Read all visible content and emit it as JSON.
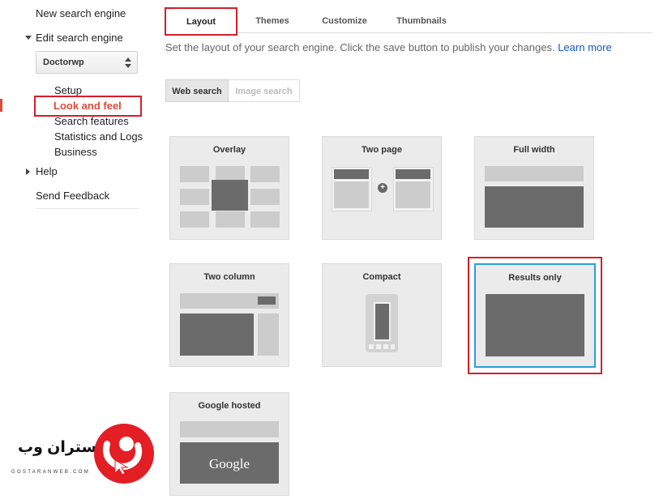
{
  "sidebar": {
    "new_search_engine": "New search engine",
    "edit_search_engine": "Edit search engine",
    "engine_select_value": "Doctorwp",
    "sub_items": [
      "Setup",
      "Look and feel",
      "Search features",
      "Statistics and Logs",
      "Business"
    ],
    "active_item": "Look and feel",
    "help": "Help",
    "send_feedback": "Send Feedback"
  },
  "tabs": [
    "Layout",
    "Themes",
    "Customize",
    "Thumbnails"
  ],
  "selected_tab": "Layout",
  "description": {
    "text": "Set the layout of your search engine. Click the save button to publish your changes.",
    "link": "Learn more"
  },
  "search_type_toggle": {
    "options": [
      "Web search",
      "Image search"
    ],
    "selected": "Web search"
  },
  "layouts": [
    {
      "title": "Overlay"
    },
    {
      "title": "Two page"
    },
    {
      "title": "Full width"
    },
    {
      "title": "Two column"
    },
    {
      "title": "Compact"
    },
    {
      "title": "Results only"
    },
    {
      "title": "Google hosted",
      "preview_text": "Google"
    }
  ],
  "selected_layout": "Results only",
  "colors": {
    "accent_red": "#dd4b39",
    "link_blue": "#1155cc",
    "highlight_box": "#d41f2b",
    "selection_border": "#2aa0d8",
    "watermark_red": "#e31e24"
  },
  "watermark": {
    "brand_text": "گستران وب",
    "brand_sub": "GOSTARANWEB.COM"
  }
}
